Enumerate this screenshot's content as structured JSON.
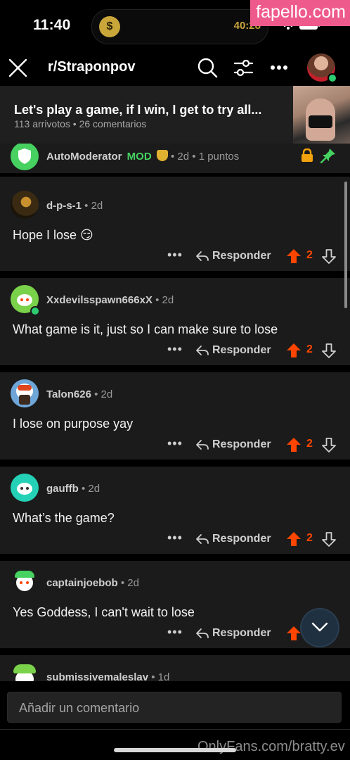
{
  "status_bar": {
    "time": "11:40",
    "island_icon": "dollar-coin-icon",
    "island_text": "40:28",
    "watermark": "fapello.com"
  },
  "header": {
    "subreddit": "r/Straponpov",
    "icons": [
      "close-icon",
      "search-icon",
      "filter-icon",
      "more-icon",
      "avatar"
    ]
  },
  "post": {
    "title": "Let's play a game, if I win, I get to try all...",
    "meta": "113 arrivotos • 26 comentarios"
  },
  "automod": {
    "author": "AutoModerator",
    "badge": "MOD",
    "meta": "• 2d • 1 puntos"
  },
  "comments": [
    {
      "author": "d-p-s-1",
      "time": "• 2d",
      "body": "Hope I lose 😏",
      "score": "2"
    },
    {
      "author": "Xxdevilsspawn666xX",
      "time": "• 2d",
      "body": "What game is it, just so I can make sure to lose",
      "score": "2"
    },
    {
      "author": "Talon626",
      "time": "• 2d",
      "body": "I lose on purpose yay",
      "score": "2"
    },
    {
      "author": "gauffb",
      "time": "• 2d",
      "body": "What’s the game?",
      "score": "2"
    },
    {
      "author": "captainjoebob",
      "time": "• 2d",
      "body": "Yes Goddess, I can't wait to lose",
      "score": ""
    },
    {
      "author": "submissivemaleslav",
      "time": "• 1d",
      "body": "",
      "score": ""
    }
  ],
  "labels": {
    "reply": "Responder",
    "dots": "•••"
  },
  "composer": {
    "placeholder": "Añadir un comentario"
  },
  "bottom_watermark": "OnlyFans.com/bratty.ev",
  "colors": {
    "upvote": "#ff4500",
    "mod_green": "#46d160",
    "background": "#000000",
    "card": "#1b1b1b"
  }
}
